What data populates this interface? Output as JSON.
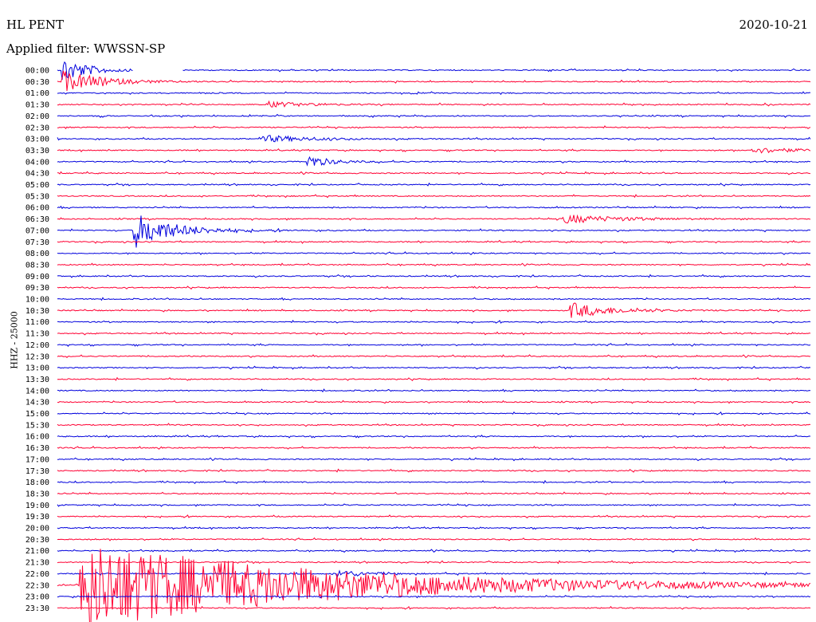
{
  "header": {
    "station": "HL PENT",
    "date": "2020-10-21",
    "filter": "Applied filter: WWSSN-SP",
    "channel": "HHZ - 25000"
  },
  "colors": {
    "even": "#0000dd",
    "odd": "#ff0033"
  },
  "chart_data": {
    "type": "seismogram",
    "title": "HL PENT",
    "date": "2020-10-21",
    "filter": "WWSSN-SP",
    "ylabel": "HHZ - 25000",
    "rows": [
      "00:00",
      "00:30",
      "01:00",
      "01:30",
      "02:00",
      "02:30",
      "03:00",
      "03:30",
      "04:00",
      "04:30",
      "05:00",
      "05:30",
      "06:00",
      "06:30",
      "07:00",
      "07:30",
      "08:00",
      "08:30",
      "09:00",
      "09:30",
      "10:00",
      "10:30",
      "11:00",
      "11:30",
      "12:00",
      "12:30",
      "13:00",
      "13:30",
      "14:00",
      "14:30",
      "15:00",
      "15:30",
      "16:00",
      "16:30",
      "17:00",
      "17:30",
      "18:00",
      "18:30",
      "19:00",
      "19:30",
      "20:00",
      "20:30",
      "21:00",
      "21:30",
      "22:00",
      "22:30",
      "23:00",
      "23:30"
    ],
    "events": [
      {
        "row": 0,
        "x": 0.005,
        "amp": 1.6,
        "dur": 0.03
      },
      {
        "row": 1,
        "x": 0.005,
        "amp": 1.2,
        "dur": 0.05
      },
      {
        "row": 3,
        "x": 0.28,
        "amp": 0.3,
        "dur": 0.05
      },
      {
        "row": 6,
        "x": 0.27,
        "amp": 0.4,
        "dur": 0.06
      },
      {
        "row": 7,
        "x": 0.92,
        "amp": 0.3,
        "dur": 0.06
      },
      {
        "row": 8,
        "x": 0.33,
        "amp": 0.7,
        "dur": 0.03
      },
      {
        "row": 13,
        "x": 0.67,
        "amp": 0.5,
        "dur": 0.07
      },
      {
        "row": 14,
        "x": 0.1,
        "amp": 2.0,
        "dur": 0.05
      },
      {
        "row": 21,
        "x": 0.68,
        "amp": 0.9,
        "dur": 0.05
      },
      {
        "row": 44,
        "x": 0.37,
        "amp": 0.5,
        "dur": 0.03
      },
      {
        "row": 45,
        "x": 0.03,
        "amp": 5.0,
        "dur": 0.3
      }
    ],
    "gap": {
      "row": 0,
      "from": 0.1,
      "to": 0.165
    },
    "xlim": [
      0,
      1
    ]
  }
}
